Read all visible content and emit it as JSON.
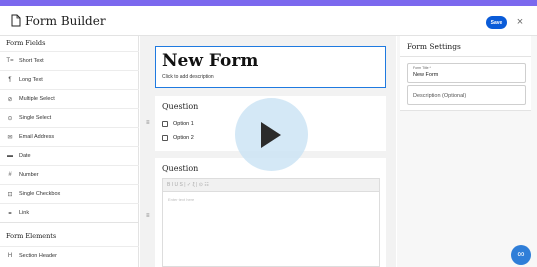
{
  "header": {
    "title": "Form Builder",
    "save_label": "Save",
    "close_glyph": "×",
    "accent_color": "#7b68ee",
    "save_color": "#0a5bd8"
  },
  "sidebar": {
    "fields_heading": "Form Fields",
    "items": [
      {
        "icon": "short-text-icon",
        "glyph": "T=",
        "label": "Short Text"
      },
      {
        "icon": "long-text-icon",
        "glyph": "¶",
        "label": "Long Text"
      },
      {
        "icon": "multiple-select-icon",
        "glyph": "⊘",
        "label": "Multiple Select"
      },
      {
        "icon": "single-select-icon",
        "glyph": "⊙",
        "label": "Single Select"
      },
      {
        "icon": "email-icon",
        "glyph": "✉",
        "label": "Email Address"
      },
      {
        "icon": "date-icon",
        "glyph": "▬",
        "label": "Date"
      },
      {
        "icon": "number-icon",
        "glyph": "#",
        "label": "Number"
      },
      {
        "icon": "checkbox-icon",
        "glyph": "⊡",
        "label": "Single Checkbox"
      },
      {
        "icon": "link-icon",
        "glyph": "⚭",
        "label": "Link"
      }
    ],
    "elements_heading": "Form Elements",
    "element_items": [
      {
        "icon": "section-header-icon",
        "glyph": "H",
        "label": "Section Header"
      }
    ]
  },
  "canvas": {
    "form_title": "New Form",
    "form_description": "Click to add description",
    "question1": {
      "title": "Question",
      "options": [
        "Option 1",
        "Option 2"
      ]
    },
    "question2": {
      "title": "Question",
      "toolbar": "B  I  U  S  |  ✓  ξ  |  ⊙  ☷",
      "placeholder": "Enter text here"
    },
    "drag_glyph": "≡"
  },
  "settings": {
    "heading": "Form Settings",
    "title_label": "Form Title *",
    "title_value": "New Form",
    "description_placeholder": "Description (Optional)"
  },
  "fab": {
    "glyph": "∞",
    "color": "#2f7ed8"
  }
}
